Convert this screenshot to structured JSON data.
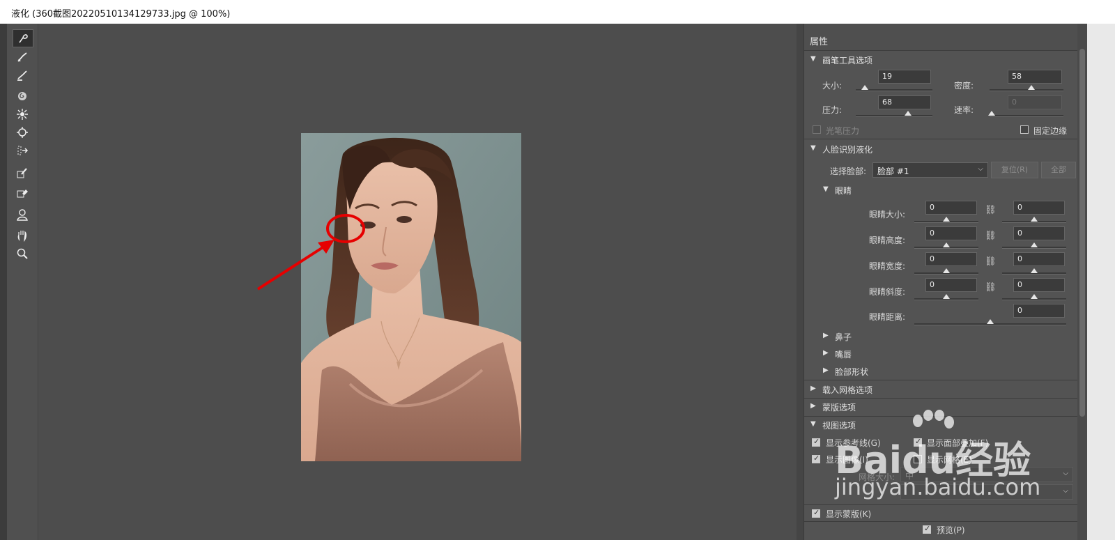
{
  "window": {
    "title": "液化 (360截图20220510134129733.jpg @ 100%)"
  },
  "panel": {
    "title": "属性"
  },
  "brush_section": {
    "title": "画笔工具选项",
    "size_label": "大小:",
    "size_value": "19",
    "size_level": 0.08,
    "density_label": "密度:",
    "density_value": "58",
    "density_level": 0.58,
    "pressure_label": "压力:",
    "pressure_value": "68",
    "pressure_level": 0.68,
    "rate_label": "速率:",
    "rate_value": "0",
    "rate_level": 0.0,
    "stylus_label": "光笔压力",
    "pin_edges_label": "固定边缘"
  },
  "face_section": {
    "title": "人脸识别液化",
    "select_face_label": "选择脸部:",
    "select_face_value": "脸部 #1",
    "reset_label": "复位(R)",
    "all_label": "全部",
    "eyes_title": "眼睛",
    "eye_rows": [
      {
        "label": "眼睛大小:",
        "left": "0",
        "right": "0"
      },
      {
        "label": "眼睛高度:",
        "left": "0",
        "right": "0"
      },
      {
        "label": "眼睛宽度:",
        "left": "0",
        "right": "0"
      },
      {
        "label": "眼睛斜度:",
        "left": "0",
        "right": "0"
      }
    ],
    "eye_distance_label": "眼睛距离:",
    "eye_distance_value": "0",
    "nose_label": "鼻子",
    "mouth_label": "嘴唇",
    "face_shape_label": "脸部形状"
  },
  "mesh_section": {
    "title": "载入网格选项"
  },
  "mask_section": {
    "title": "蒙版选项"
  },
  "view_section": {
    "title": "视图选项",
    "show_guides": "显示参考线(G)",
    "show_face_overlay": "显示面部叠加(F)",
    "show_image": "显示图像(I)",
    "show_mesh": "显示网格(E)",
    "mesh_size": "网格大小:",
    "mesh_size_value": "中",
    "show_mask": "显示蒙版(K)"
  },
  "preview_label": "预览(P)",
  "watermark": {
    "main": "Baidu经验",
    "sub": "jingyan.baidu.com"
  },
  "colors": {
    "panel": "#535353",
    "canvas": "#4d4d4d",
    "annotation": "#e60000"
  },
  "tool_icons": [
    "forward-warp-icon",
    "reconstruct-icon",
    "smooth-icon",
    "twirl-icon",
    "pucker-icon",
    "bloat-icon",
    "push-left-icon",
    "freeze-mask-icon",
    "thaw-mask-icon",
    "face-tool-icon",
    "hand-icon",
    "zoom-icon"
  ]
}
